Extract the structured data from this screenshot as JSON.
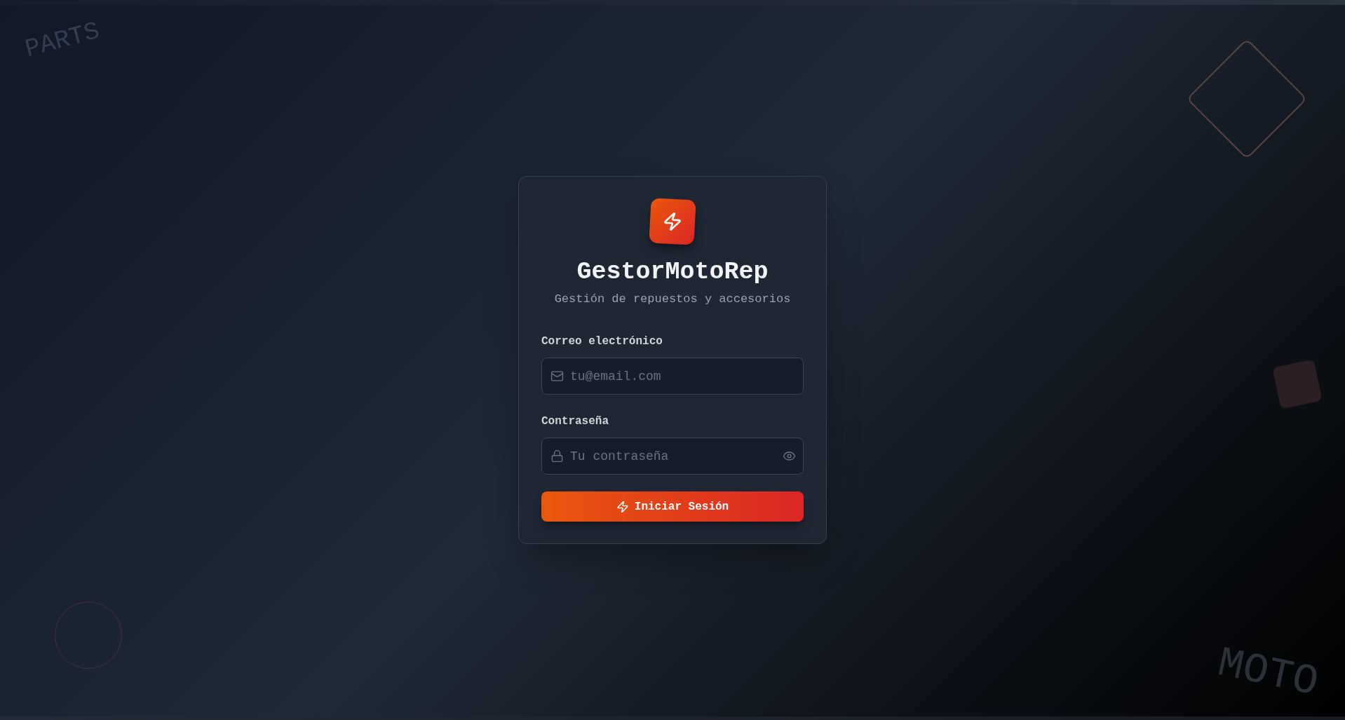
{
  "background_words": [
    "PARTS",
    "MOTO"
  ],
  "login_card": {
    "app_name": "GestorMotoRep",
    "tagline": "Gestión de repuestos y accesorios",
    "fields": [
      {
        "kind": "email",
        "label": "Correo electrónico",
        "placeholder": "tu@email.com"
      },
      {
        "kind": "password",
        "label": "Contraseña",
        "placeholder": "Tu contraseña"
      }
    ],
    "submit_button": "Iniciar Sesión"
  }
}
